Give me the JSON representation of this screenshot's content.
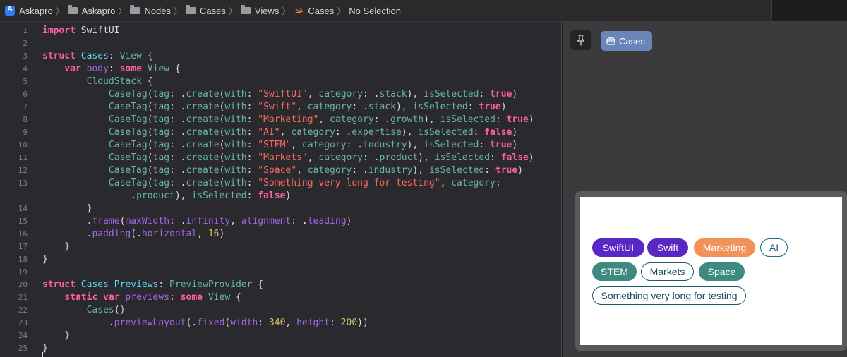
{
  "breadcrumb": [
    {
      "label": "Askapro",
      "icon": "app-icon"
    },
    {
      "label": "Askapro",
      "icon": "folder-icon"
    },
    {
      "label": "Nodes",
      "icon": "folder-icon"
    },
    {
      "label": "Cases",
      "icon": "folder-icon"
    },
    {
      "label": "Views",
      "icon": "folder-icon"
    },
    {
      "label": "Cases",
      "icon": "swift-file-icon"
    },
    {
      "label": "No Selection",
      "icon": ""
    }
  ],
  "editor": {
    "lines": [
      {
        "n": "1",
        "t": [
          [
            "kw",
            "import"
          ],
          [
            "pl",
            " SwiftUI"
          ]
        ]
      },
      {
        "n": "2",
        "t": []
      },
      {
        "n": "3",
        "t": [
          [
            "kw",
            "struct"
          ],
          [
            "pl",
            " "
          ],
          [
            "ty",
            "Cases"
          ],
          [
            "pl",
            ": "
          ],
          [
            "ptype",
            "View"
          ],
          [
            "pl",
            " {"
          ]
        ]
      },
      {
        "n": "4",
        "t": [
          [
            "pl",
            "    "
          ],
          [
            "kw",
            "var"
          ],
          [
            "pl",
            " "
          ],
          [
            "pc",
            "body"
          ],
          [
            "pl",
            ": "
          ],
          [
            "kw",
            "some"
          ],
          [
            "pl",
            " "
          ],
          [
            "ptype",
            "View"
          ],
          [
            "pl",
            " {"
          ]
        ]
      },
      {
        "n": "5",
        "t": [
          [
            "pl",
            "        "
          ],
          [
            "fn",
            "CloudStack"
          ],
          [
            "pl",
            " {"
          ]
        ]
      },
      {
        "n": "6",
        "t": [
          [
            "pl",
            "            "
          ],
          [
            "fn",
            "CaseTag"
          ],
          [
            "pl",
            "("
          ],
          [
            "fn",
            "tag"
          ],
          [
            "pl",
            ": ."
          ],
          [
            "fn",
            "create"
          ],
          [
            "pl",
            "("
          ],
          [
            "fn",
            "with"
          ],
          [
            "pl",
            ": "
          ],
          [
            "str",
            "\"SwiftUI\""
          ],
          [
            "pl",
            ", "
          ],
          [
            "fn",
            "category"
          ],
          [
            "pl",
            ": ."
          ],
          [
            "fn",
            "stack"
          ],
          [
            "pl",
            "), "
          ],
          [
            "fn",
            "isSelected"
          ],
          [
            "pl",
            ": "
          ],
          [
            "kw",
            "true"
          ],
          [
            "pl",
            ")"
          ]
        ]
      },
      {
        "n": "7",
        "t": [
          [
            "pl",
            "            "
          ],
          [
            "fn",
            "CaseTag"
          ],
          [
            "pl",
            "("
          ],
          [
            "fn",
            "tag"
          ],
          [
            "pl",
            ": ."
          ],
          [
            "fn",
            "create"
          ],
          [
            "pl",
            "("
          ],
          [
            "fn",
            "with"
          ],
          [
            "pl",
            ": "
          ],
          [
            "str",
            "\"Swift\""
          ],
          [
            "pl",
            ", "
          ],
          [
            "fn",
            "category"
          ],
          [
            "pl",
            ": ."
          ],
          [
            "fn",
            "stack"
          ],
          [
            "pl",
            "), "
          ],
          [
            "fn",
            "isSelected"
          ],
          [
            "pl",
            ": "
          ],
          [
            "kw",
            "true"
          ],
          [
            "pl",
            ")"
          ]
        ]
      },
      {
        "n": "8",
        "t": [
          [
            "pl",
            "            "
          ],
          [
            "fn",
            "CaseTag"
          ],
          [
            "pl",
            "("
          ],
          [
            "fn",
            "tag"
          ],
          [
            "pl",
            ": ."
          ],
          [
            "fn",
            "create"
          ],
          [
            "pl",
            "("
          ],
          [
            "fn",
            "with"
          ],
          [
            "pl",
            ": "
          ],
          [
            "str",
            "\"Marketing\""
          ],
          [
            "pl",
            ", "
          ],
          [
            "fn",
            "category"
          ],
          [
            "pl",
            ": ."
          ],
          [
            "fn",
            "growth"
          ],
          [
            "pl",
            "), "
          ],
          [
            "fn",
            "isSelected"
          ],
          [
            "pl",
            ": "
          ],
          [
            "kw",
            "true"
          ],
          [
            "pl",
            ")"
          ]
        ]
      },
      {
        "n": "9",
        "t": [
          [
            "pl",
            "            "
          ],
          [
            "fn",
            "CaseTag"
          ],
          [
            "pl",
            "("
          ],
          [
            "fn",
            "tag"
          ],
          [
            "pl",
            ": ."
          ],
          [
            "fn",
            "create"
          ],
          [
            "pl",
            "("
          ],
          [
            "fn",
            "with"
          ],
          [
            "pl",
            ": "
          ],
          [
            "str",
            "\"AI\""
          ],
          [
            "pl",
            ", "
          ],
          [
            "fn",
            "category"
          ],
          [
            "pl",
            ": ."
          ],
          [
            "fn",
            "expertise"
          ],
          [
            "pl",
            "), "
          ],
          [
            "fn",
            "isSelected"
          ],
          [
            "pl",
            ": "
          ],
          [
            "kw",
            "false"
          ],
          [
            "pl",
            ")"
          ]
        ]
      },
      {
        "n": "10",
        "t": [
          [
            "pl",
            "            "
          ],
          [
            "fn",
            "CaseTag"
          ],
          [
            "pl",
            "("
          ],
          [
            "fn",
            "tag"
          ],
          [
            "pl",
            ": ."
          ],
          [
            "fn",
            "create"
          ],
          [
            "pl",
            "("
          ],
          [
            "fn",
            "with"
          ],
          [
            "pl",
            ": "
          ],
          [
            "str",
            "\"STEM\""
          ],
          [
            "pl",
            ", "
          ],
          [
            "fn",
            "category"
          ],
          [
            "pl",
            ": ."
          ],
          [
            "fn",
            "industry"
          ],
          [
            "pl",
            "), "
          ],
          [
            "fn",
            "isSelected"
          ],
          [
            "pl",
            ": "
          ],
          [
            "kw",
            "true"
          ],
          [
            "pl",
            ")"
          ]
        ]
      },
      {
        "n": "11",
        "t": [
          [
            "pl",
            "            "
          ],
          [
            "fn",
            "CaseTag"
          ],
          [
            "pl",
            "("
          ],
          [
            "fn",
            "tag"
          ],
          [
            "pl",
            ": ."
          ],
          [
            "fn",
            "create"
          ],
          [
            "pl",
            "("
          ],
          [
            "fn",
            "with"
          ],
          [
            "pl",
            ": "
          ],
          [
            "str",
            "\"Markets\""
          ],
          [
            "pl",
            ", "
          ],
          [
            "fn",
            "category"
          ],
          [
            "pl",
            ": ."
          ],
          [
            "fn",
            "product"
          ],
          [
            "pl",
            "), "
          ],
          [
            "fn",
            "isSelected"
          ],
          [
            "pl",
            ": "
          ],
          [
            "kw",
            "false"
          ],
          [
            "pl",
            ")"
          ]
        ]
      },
      {
        "n": "12",
        "t": [
          [
            "pl",
            "            "
          ],
          [
            "fn",
            "CaseTag"
          ],
          [
            "pl",
            "("
          ],
          [
            "fn",
            "tag"
          ],
          [
            "pl",
            ": ."
          ],
          [
            "fn",
            "create"
          ],
          [
            "pl",
            "("
          ],
          [
            "fn",
            "with"
          ],
          [
            "pl",
            ": "
          ],
          [
            "str",
            "\"Space\""
          ],
          [
            "pl",
            ", "
          ],
          [
            "fn",
            "category"
          ],
          [
            "pl",
            ": ."
          ],
          [
            "fn",
            "industry"
          ],
          [
            "pl",
            "), "
          ],
          [
            "fn",
            "isSelected"
          ],
          [
            "pl",
            ": "
          ],
          [
            "kw",
            "true"
          ],
          [
            "pl",
            ")"
          ]
        ]
      },
      {
        "n": "13",
        "t": [
          [
            "pl",
            "            "
          ],
          [
            "fn",
            "CaseTag"
          ],
          [
            "pl",
            "("
          ],
          [
            "fn",
            "tag"
          ],
          [
            "pl",
            ": ."
          ],
          [
            "fn",
            "create"
          ],
          [
            "pl",
            "("
          ],
          [
            "fn",
            "with"
          ],
          [
            "pl",
            ": "
          ],
          [
            "str",
            "\"Something very long for testing\""
          ],
          [
            "pl",
            ", "
          ],
          [
            "fn",
            "category"
          ],
          [
            "pl",
            ":"
          ]
        ]
      },
      {
        "n": "",
        "t": [
          [
            "pl",
            "                ."
          ],
          [
            "fn",
            "product"
          ],
          [
            "pl",
            "), "
          ],
          [
            "fn",
            "isSelected"
          ],
          [
            "pl",
            ": "
          ],
          [
            "kw",
            "false"
          ],
          [
            "pl",
            ")"
          ]
        ]
      },
      {
        "n": "14",
        "t": [
          [
            "pl",
            "        }"
          ]
        ]
      },
      {
        "n": "15",
        "t": [
          [
            "pl",
            "        ."
          ],
          [
            "pc",
            "frame"
          ],
          [
            "pl",
            "("
          ],
          [
            "pc",
            "maxWidth"
          ],
          [
            "pl",
            ": ."
          ],
          [
            "pc",
            "infinity"
          ],
          [
            "pl",
            ", "
          ],
          [
            "pc",
            "alignment"
          ],
          [
            "pl",
            ": ."
          ],
          [
            "pc",
            "leading"
          ],
          [
            "pl",
            ")"
          ]
        ]
      },
      {
        "n": "16",
        "t": [
          [
            "pl",
            "        ."
          ],
          [
            "pc",
            "padding"
          ],
          [
            "pl",
            "(."
          ],
          [
            "pc",
            "horizontal"
          ],
          [
            "pl",
            ", "
          ],
          [
            "num-lit",
            "16"
          ],
          [
            "pl",
            ")"
          ]
        ]
      },
      {
        "n": "17",
        "t": [
          [
            "pl",
            "    }"
          ]
        ]
      },
      {
        "n": "18",
        "t": [
          [
            "pl",
            "}"
          ]
        ]
      },
      {
        "n": "19",
        "t": []
      },
      {
        "n": "20",
        "t": [
          [
            "kw",
            "struct"
          ],
          [
            "pl",
            " "
          ],
          [
            "ty",
            "Cases_Previews"
          ],
          [
            "pl",
            ": "
          ],
          [
            "ptype",
            "PreviewProvider"
          ],
          [
            "pl",
            " {"
          ]
        ]
      },
      {
        "n": "21",
        "t": [
          [
            "pl",
            "    "
          ],
          [
            "kw",
            "static"
          ],
          [
            "pl",
            " "
          ],
          [
            "kw",
            "var"
          ],
          [
            "pl",
            " "
          ],
          [
            "pc",
            "previews"
          ],
          [
            "pl",
            ": "
          ],
          [
            "kw",
            "some"
          ],
          [
            "pl",
            " "
          ],
          [
            "ptype",
            "View"
          ],
          [
            "pl",
            " {"
          ]
        ]
      },
      {
        "n": "22",
        "t": [
          [
            "pl",
            "        "
          ],
          [
            "fn",
            "Cases"
          ],
          [
            "pl",
            "()"
          ]
        ]
      },
      {
        "n": "23",
        "t": [
          [
            "pl",
            "            ."
          ],
          [
            "pc",
            "previewLayout"
          ],
          [
            "pl",
            "(."
          ],
          [
            "pc",
            "fixed"
          ],
          [
            "pl",
            "("
          ],
          [
            "pc",
            "width"
          ],
          [
            "pl",
            ": "
          ],
          [
            "num-lit",
            "340"
          ],
          [
            "pl",
            ", "
          ],
          [
            "pc",
            "height"
          ],
          [
            "pl",
            ": "
          ],
          [
            "num-lit",
            "200"
          ],
          [
            "pl",
            "))"
          ]
        ]
      },
      {
        "n": "24",
        "t": [
          [
            "pl",
            "    }"
          ]
        ]
      },
      {
        "n": "25",
        "t": [
          [
            "pl",
            "}"
          ]
        ]
      },
      {
        "n": "26",
        "t": []
      }
    ]
  },
  "canvas": {
    "pin_icon": "pin-icon",
    "cases_chip_label": "Cases",
    "tags": [
      {
        "label": "SwiftUI",
        "bg": "#5828c5",
        "fg": "#ffffff",
        "border": "#5828c5"
      },
      {
        "label": "Swift",
        "bg": "#5828c5",
        "fg": "#ffffff",
        "border": "#5828c5"
      },
      {
        "label": "Marketing",
        "bg": "#f0925a",
        "fg": "#ffffff",
        "border": "#f0925a"
      },
      {
        "label": "AI",
        "bg": "#ffffff",
        "fg": "#1d5c7d",
        "border": "#1d6e80"
      },
      {
        "label": "STEM",
        "bg": "#3f8a80",
        "fg": "#ffffff",
        "border": "#3f8a80"
      },
      {
        "label": "Markets",
        "bg": "#ffffff",
        "fg": "#1d4c5c",
        "border": "#1d5c6c"
      },
      {
        "label": "Space",
        "bg": "#3f8a80",
        "fg": "#ffffff",
        "border": "#3f8a80"
      },
      {
        "label": "Something very long for testing",
        "bg": "#ffffff",
        "fg": "#1d4c5c",
        "border": "#1d5c6c"
      }
    ]
  }
}
